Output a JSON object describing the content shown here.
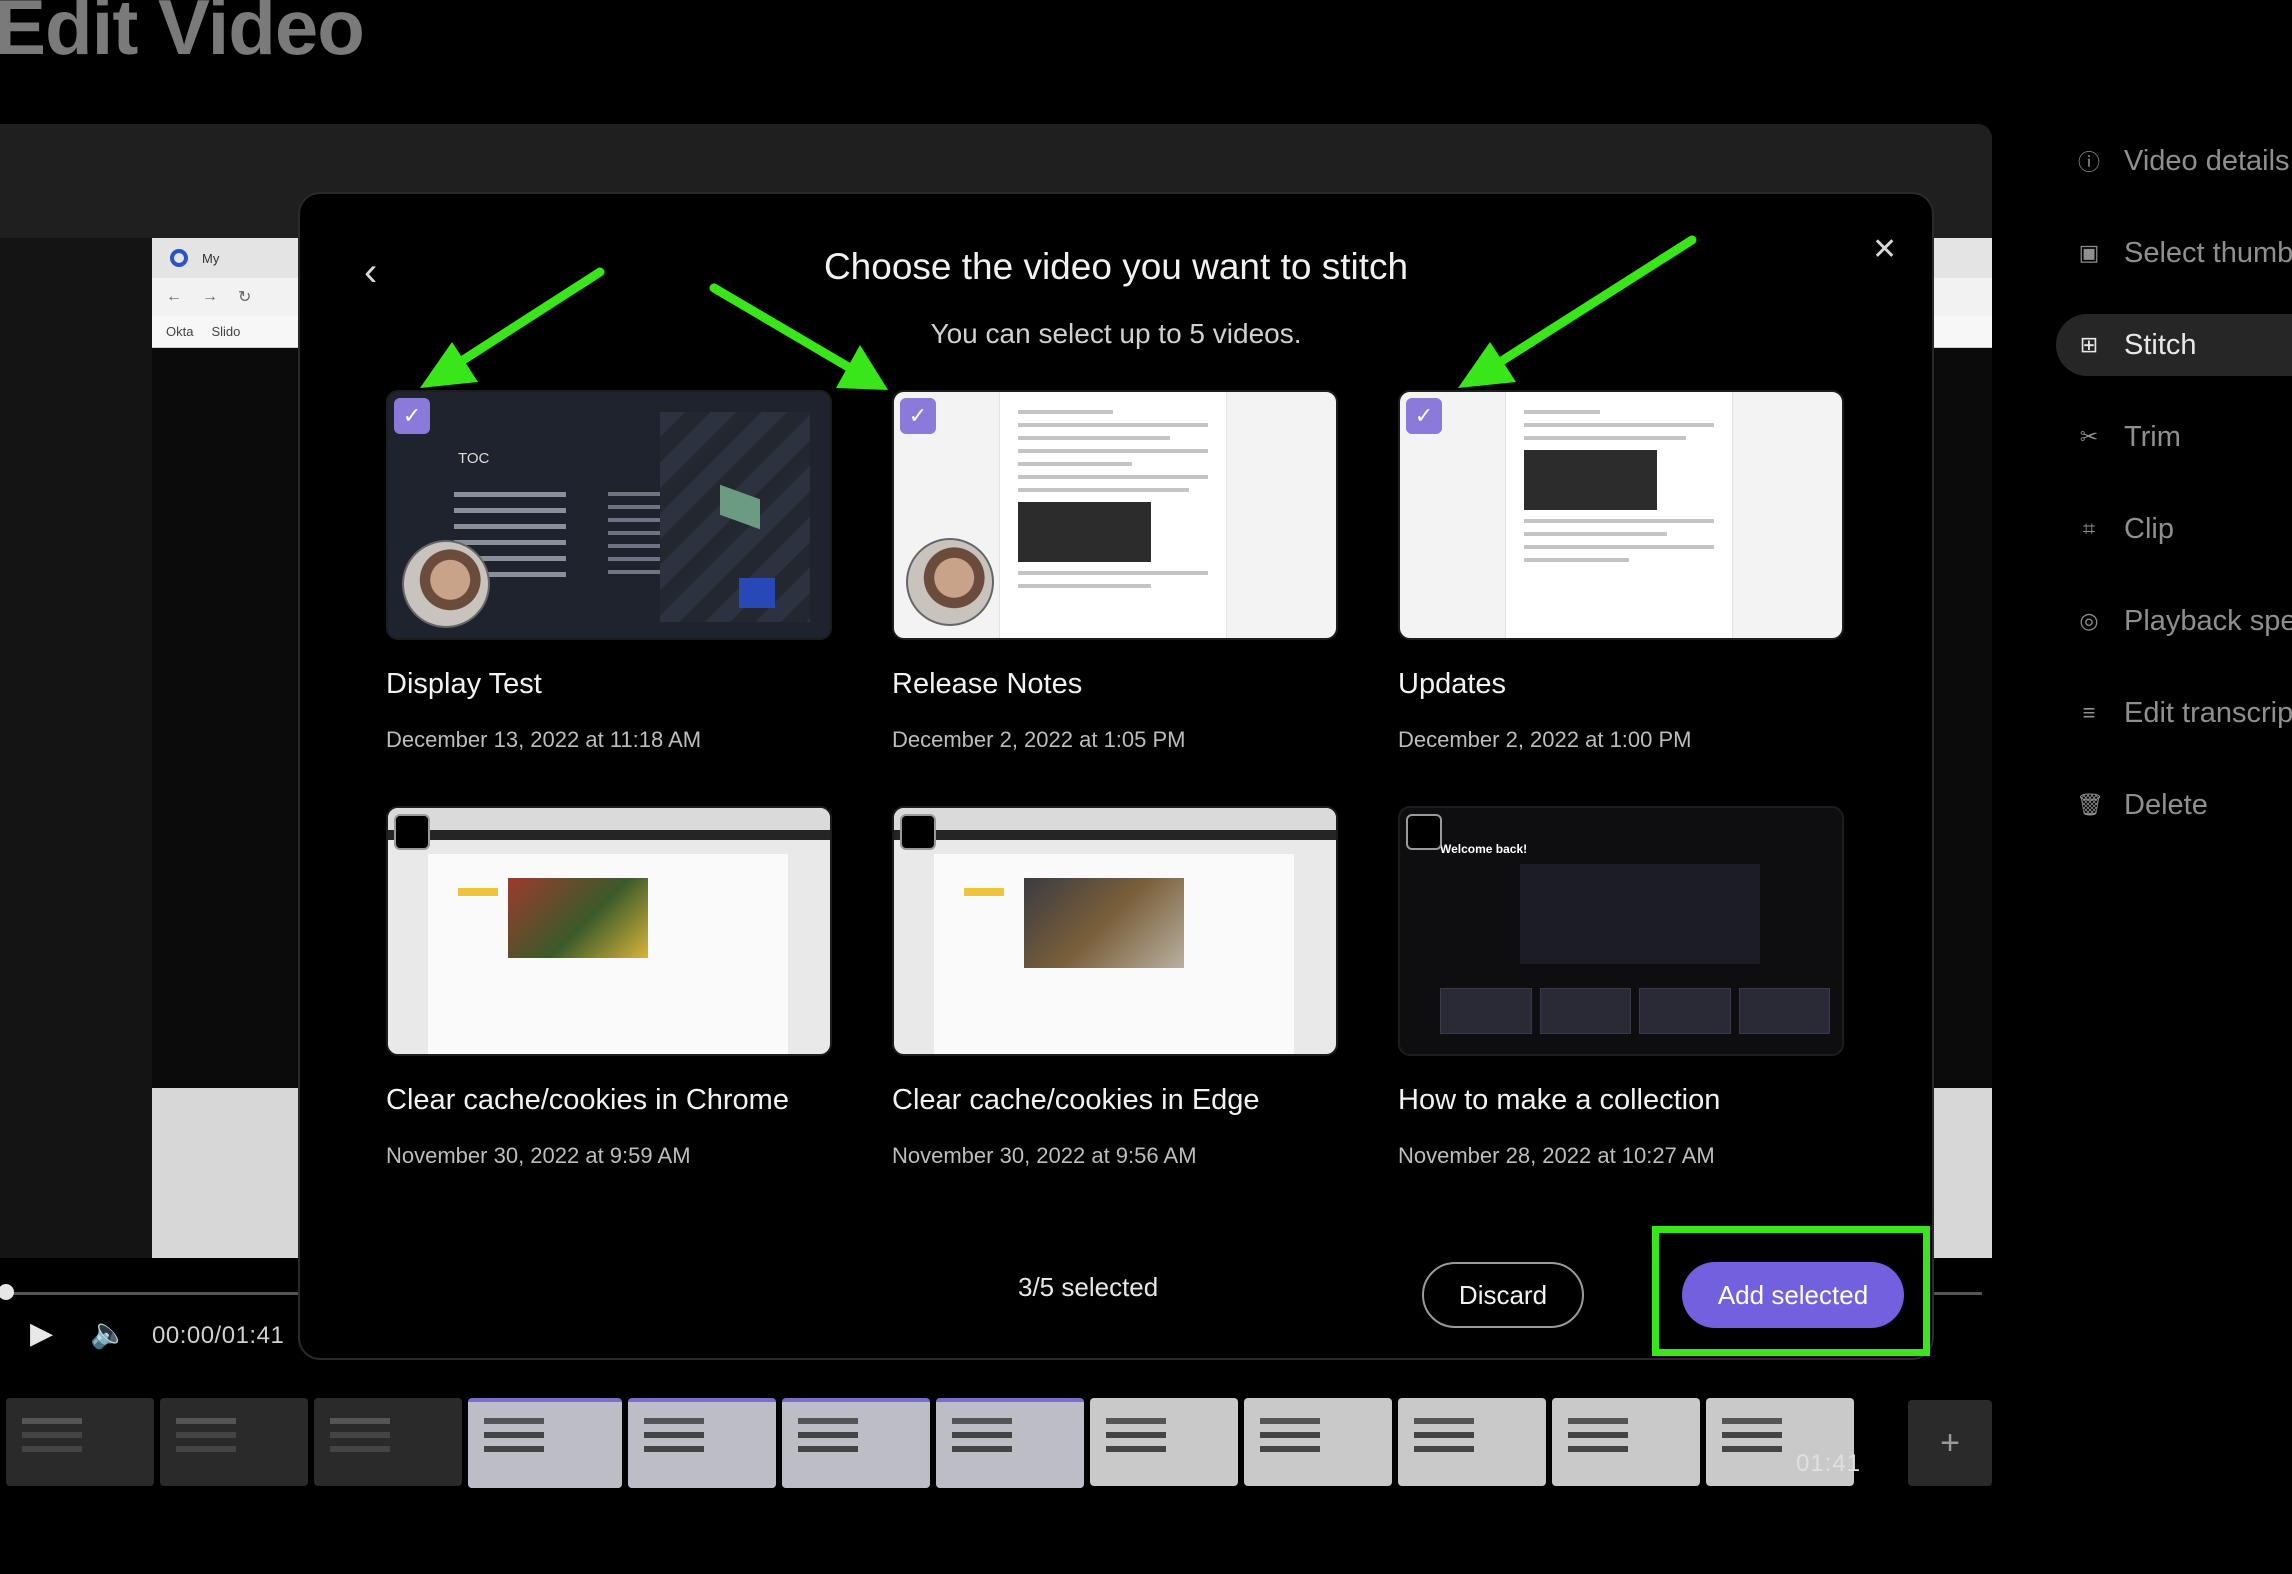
{
  "page": {
    "title": "Edit Video"
  },
  "player": {
    "browser_tab": "My",
    "bookmarks": [
      "Okta",
      "Slido"
    ],
    "time": "00:00/01:41",
    "timeline_end": "01:41",
    "add_icon": "plus-icon"
  },
  "sidebar": {
    "items": [
      {
        "label": "Video details",
        "icon": "info-icon"
      },
      {
        "label": "Select thumb",
        "icon": "image-icon"
      },
      {
        "label": "Stitch",
        "icon": "stitch-icon",
        "active": true
      },
      {
        "label": "Trim",
        "icon": "scissors-icon"
      },
      {
        "label": "Clip",
        "icon": "crop-icon"
      },
      {
        "label": "Playback spe",
        "icon": "speed-icon"
      },
      {
        "label": "Edit transcrip",
        "icon": "lines-icon"
      },
      {
        "label": "Delete",
        "icon": "trash-icon"
      }
    ]
  },
  "modal": {
    "title": "Choose the video you want to stitch",
    "subtitle": "You can select up to 5 videos.",
    "videos": [
      {
        "title": "Display Test",
        "date": "December 13, 2022 at 11:18 AM",
        "selected": true,
        "thumb_text": "TOC"
      },
      {
        "title": "Release Notes",
        "date": "December 2, 2022 at 1:05 PM",
        "selected": true
      },
      {
        "title": "Updates",
        "date": "December 2, 2022 at 1:00 PM",
        "selected": true
      },
      {
        "title": "Clear cache/cookies in Chrome",
        "date": "November 30, 2022 at 9:59 AM",
        "selected": false
      },
      {
        "title": "Clear cache/cookies in Edge",
        "date": "November 30, 2022 at 9:56 AM",
        "selected": false
      },
      {
        "title": "How to make a collection",
        "date": "November 28, 2022 at 10:27 AM",
        "selected": false,
        "thumb_text": "Welcome back!"
      }
    ],
    "selected_count": "3/5 selected",
    "discard_label": "Discard",
    "add_label": "Add selected"
  },
  "colors": {
    "accent": "#7360df",
    "check": "#8b7ad9",
    "annotation": "#39e61a"
  }
}
